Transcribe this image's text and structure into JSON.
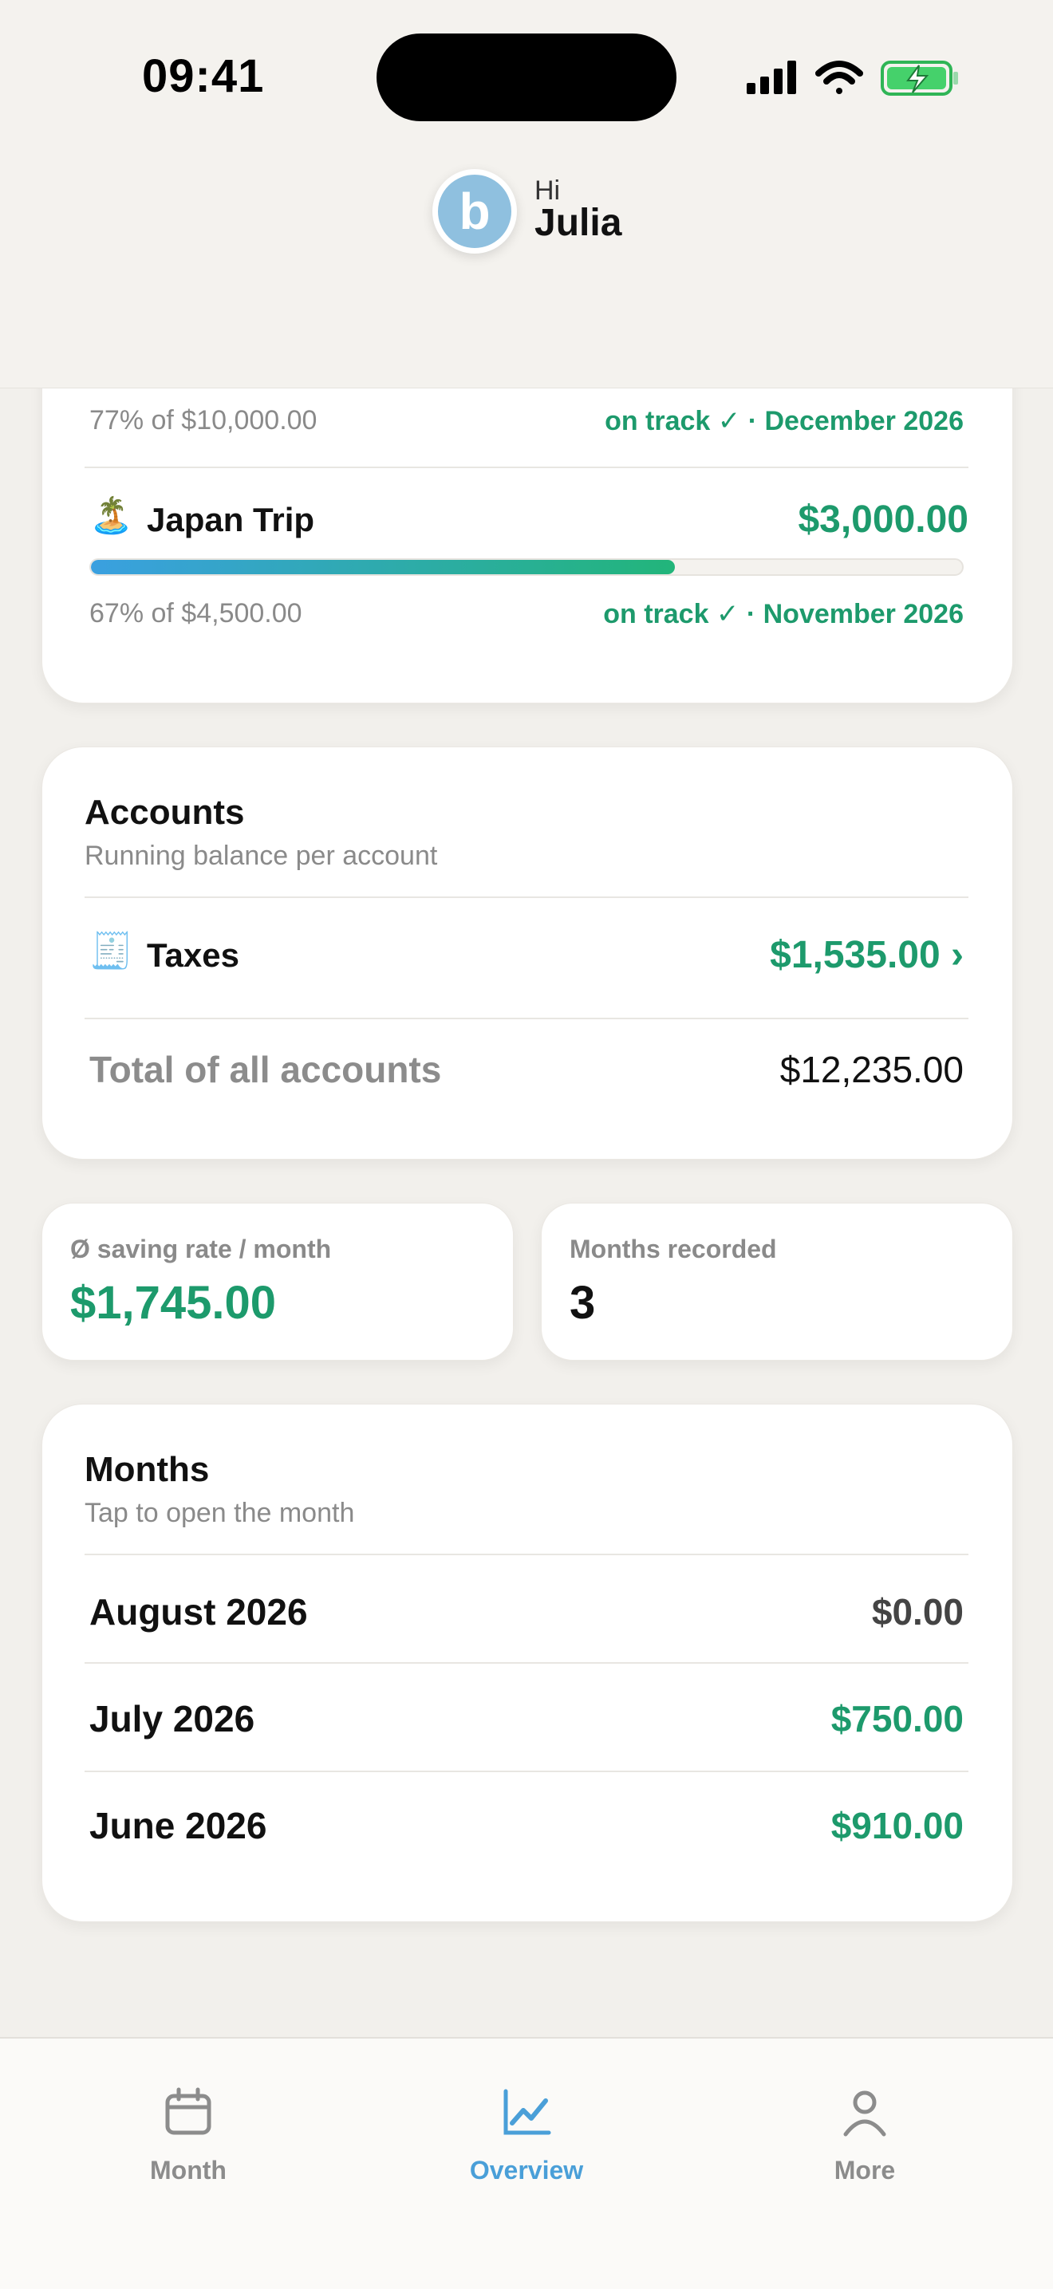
{
  "status_bar": {
    "time": "09:41"
  },
  "header": {
    "greeting": "Hi",
    "user_name": "Julia",
    "avatar_letter": "b"
  },
  "goals": {
    "previous": {
      "progress_text": "77% of $10,000.00",
      "status_text": "on track ✓ · December 2026"
    },
    "japan_trip": {
      "emoji": "🏝️",
      "name": "Japan Trip",
      "amount": "$3,000.00",
      "progress": 0.67,
      "progress_text": "67% of $4,500.00",
      "status_text": "on track ✓ · November 2026"
    }
  },
  "accounts": {
    "title": "Accounts",
    "subtitle": "Running balance per account",
    "items": [
      {
        "emoji": "🧾",
        "name": "Taxes",
        "amount": "$1,535.00",
        "chevron": "›"
      }
    ],
    "total_label": "Total of all accounts",
    "total_value": "$12,235.00"
  },
  "stats": {
    "saving_rate_label": "Ø saving rate / month",
    "saving_rate_value": "$1,745.00",
    "months_recorded_label": "Months recorded",
    "months_recorded_value": "3"
  },
  "months": {
    "title": "Months",
    "subtitle": "Tap to open the month",
    "items": [
      {
        "label": "August 2026",
        "amount": "$0.00"
      },
      {
        "label": "July 2026",
        "amount": "$750.00"
      },
      {
        "label": "June 2026",
        "amount": "$910.00"
      }
    ]
  },
  "tabbar": {
    "tabs": [
      {
        "label": "Month",
        "icon": "calendar-icon"
      },
      {
        "label": "Overview",
        "icon": "chart-icon"
      },
      {
        "label": "More",
        "icon": "person-icon"
      }
    ],
    "active": "Overview"
  },
  "colors": {
    "accent_green": "#1d9a6c",
    "accent_blue": "#4a9fd8",
    "background": "#f2f0ec"
  }
}
